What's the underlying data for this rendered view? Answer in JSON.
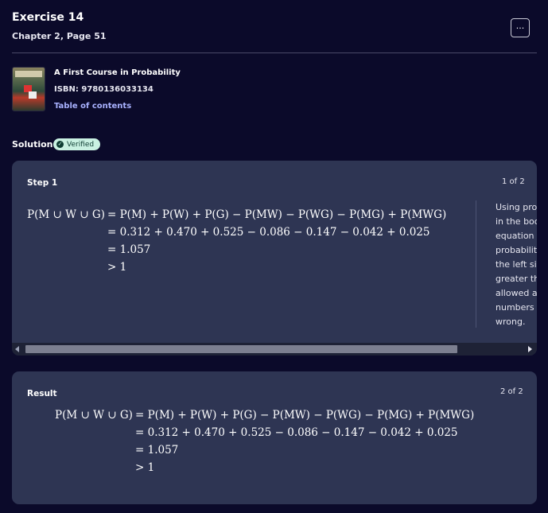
{
  "header": {
    "title": "Exercise 14",
    "subtitle": "Chapter 2, Page 51",
    "more_label": "···"
  },
  "book": {
    "name": "A First Course in Probability",
    "isbn": "ISBN: 9780136033134",
    "toc_link": "Table of contents"
  },
  "solution": {
    "label": "Solution",
    "badge": "Verified"
  },
  "step1": {
    "label": "Step 1",
    "counter": "1 of 2",
    "equation": {
      "lhs": "P(M ∪ W ∪ G)",
      "rhs1": "= P(M) + P(W) + P(G) − P(MW) − P(WG) − P(MG) + P(MWG)",
      "rhs2": "= 0.312  +  0.470  +  0.525  −  0.086  −  0.147  −  0.042  +  0.025",
      "rhs3": "= 1.057",
      "rhs4": "> 1"
    },
    "explanation": [
      "Using pro",
      "in the boo",
      "equation",
      "probabilit",
      "the left si",
      "greater th",
      "allowed a",
      "numbers",
      "wrong."
    ]
  },
  "result": {
    "label": "Result",
    "counter": "2 of 2",
    "equation": {
      "lhs": "P(M ∪ W ∪ G)",
      "rhs1": "= P(M) + P(W) + P(G) − P(MW) − P(WG) − P(MG) + P(MWG)",
      "rhs2": "= 0.312  +  0.470  +  0.525  −  0.086  −  0.147  −  0.042  +  0.025",
      "rhs3": "= 1.057",
      "rhs4": "> 1"
    }
  },
  "colors": {
    "background": "#0b0a2a",
    "card": "#2e3553",
    "link": "#a9b2ff",
    "badge_bg": "#c9f1e2"
  },
  "icons": {
    "more": "ellipsis-icon",
    "verified": "check-circle-icon",
    "scroll_left": "arrow-left-icon",
    "scroll_right": "arrow-right-icon"
  }
}
